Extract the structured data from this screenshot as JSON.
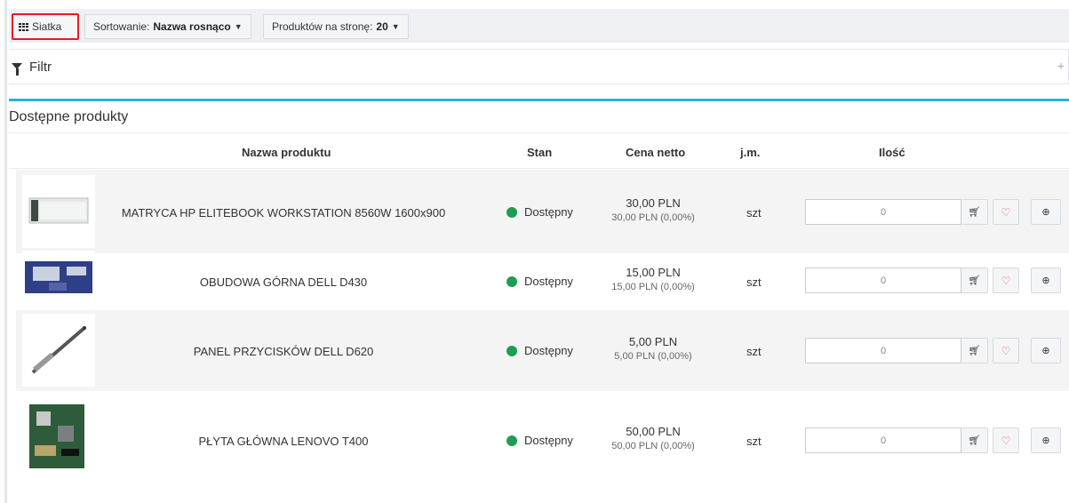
{
  "toolbar": {
    "grid_label": "Siatka",
    "sort_prefix": "Sortowanie:",
    "sort_value": "Nazwa rosnąco",
    "per_page_prefix": "Produktów na stronę:",
    "per_page_value": "20"
  },
  "filter": {
    "label": "Filtr",
    "toggle": "+"
  },
  "panel": {
    "title": "Dostępne produkty"
  },
  "table": {
    "headers": {
      "name": "Nazwa produktu",
      "stock": "Stan",
      "price": "Cena netto",
      "unit": "j.m.",
      "qty": "Ilość"
    },
    "rows": [
      {
        "name": "MATRYCA HP ELITEBOOK WORKSTATION 8560W 1600x900",
        "stock": "Dostępny",
        "price": "30,00 PLN",
        "price_sub": "30,00 PLN (0,00%)",
        "unit": "szt",
        "qty": "0"
      },
      {
        "name": "OBUDOWA GÓRNA DELL D430",
        "stock": "Dostępny",
        "price": "15,00 PLN",
        "price_sub": "15,00 PLN (0,00%)",
        "unit": "szt",
        "qty": "0"
      },
      {
        "name": "PANEL PRZYCISKÓW DELL D620",
        "stock": "Dostępny",
        "price": "5,00 PLN",
        "price_sub": "5,00 PLN (0,00%)",
        "unit": "szt",
        "qty": "0"
      },
      {
        "name": "PŁYTA GŁÓWNA LENOVO T400",
        "stock": "Dostępny",
        "price": "50,00 PLN",
        "price_sub": "50,00 PLN (0,00%)",
        "unit": "szt",
        "qty": "0"
      }
    ]
  },
  "colors": {
    "accent": "#27b2dd",
    "available": "#1f9d55",
    "highlight": "#e31b23"
  }
}
